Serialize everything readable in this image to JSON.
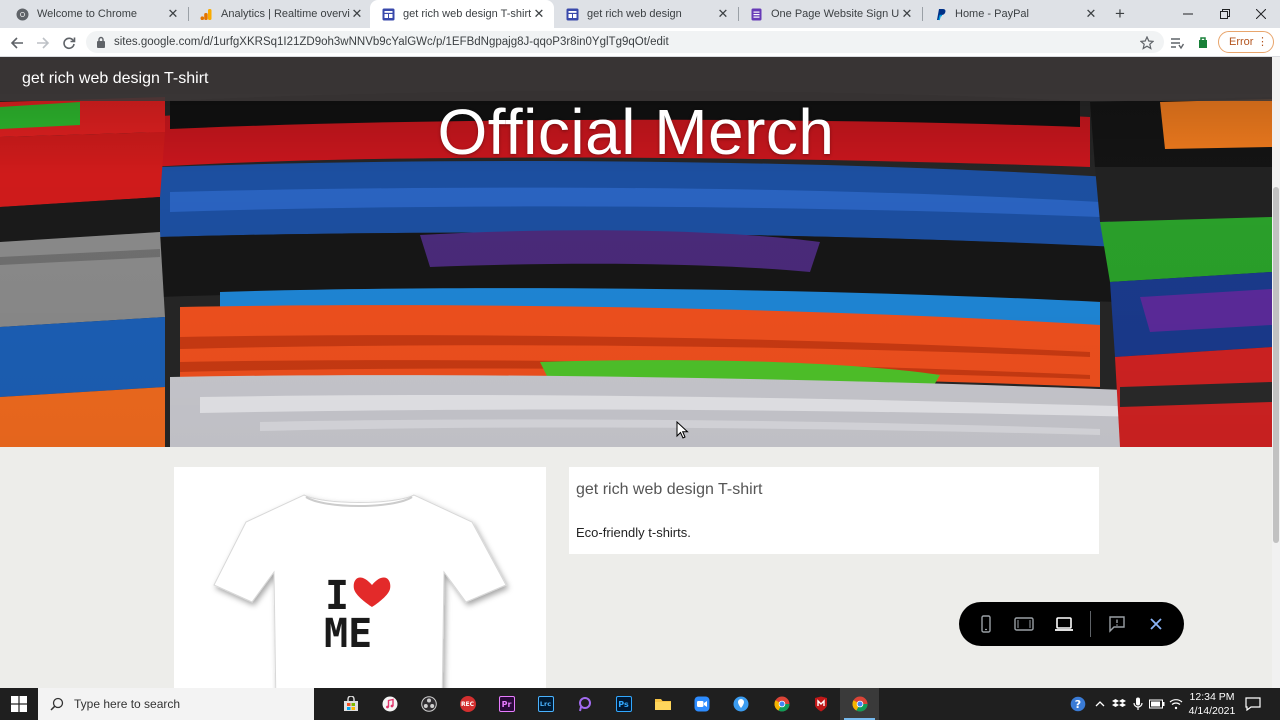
{
  "browser": {
    "tabs": [
      {
        "title": "Welcome to Chrome",
        "icon": "chrome-icon",
        "active": false
      },
      {
        "title": "Analytics | Realtime overview",
        "icon": "analytics-icon",
        "active": false
      },
      {
        "title": "get rich web design T-shirt",
        "icon": "google-sites-icon",
        "active": true
      },
      {
        "title": "get rich web design",
        "icon": "google-sites-icon",
        "active": false
      },
      {
        "title": "One Page Website Sign Up",
        "icon": "google-forms-icon",
        "active": false
      },
      {
        "title": "Home - PayPal",
        "icon": "paypal-icon",
        "active": false
      }
    ],
    "close_glyph": "✕",
    "new_tab_glyph": "+",
    "url": "sites.google.com/d/1urfgXKRSq1I21ZD9oh3wNNVb9cYalGWc/p/1EFBdNgpajg8J-qqoP3r8in0YglTg9qOt/edit",
    "error_label": "Error"
  },
  "site": {
    "title": "get rich web design T-shirt",
    "hero_heading": "Official Merch",
    "product": {
      "title": "get rich web design T-shirt",
      "description": "Eco-friendly t-shirts.",
      "shirt_print_line1": "I",
      "shirt_print_line2": "ME"
    }
  },
  "preview_toolbar": {
    "icons": [
      "phone-preview-icon",
      "tablet-preview-icon",
      "laptop-preview-icon",
      "feedback-icon",
      "close-preview-icon"
    ]
  },
  "taskbar": {
    "search_placeholder": "Type here to search",
    "apps": [
      "store-icon",
      "itunes-icon",
      "obs-icon",
      "rec-icon",
      "premiere-icon",
      "lightroom-icon",
      "pinwheel-icon",
      "photoshop-icon",
      "file-explorer-icon",
      "zoom-icon",
      "maps-pin-icon",
      "chrome-icon",
      "mcafee-icon",
      "chrome-icon"
    ],
    "app_letters": {
      "premiere": "Pr",
      "lightroom": "Lrc",
      "photoshop": "Ps",
      "rec": "REC"
    },
    "time": "12:34 PM",
    "date": "4/14/2021"
  },
  "colors": {
    "accent_blue": "#1a73e8",
    "error_orange": "#b3541e",
    "page_bg": "#ededea",
    "heart_red": "#e32a2a"
  }
}
